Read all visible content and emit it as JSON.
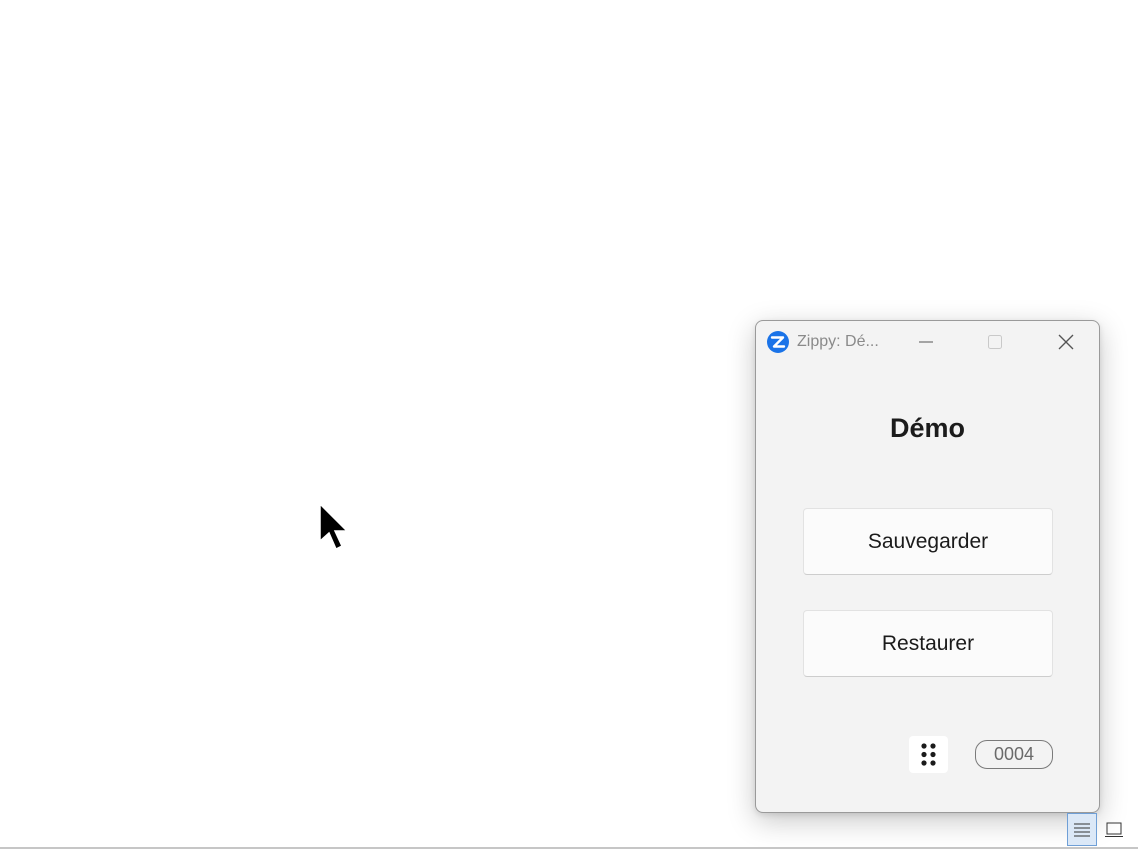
{
  "window": {
    "title": "Zippy: Dé...",
    "icon": "zippy-app-icon",
    "controls": {
      "minimize_icon": "minimize-icon",
      "maximize_icon": "maximize-icon",
      "close_icon": "close-icon"
    }
  },
  "main": {
    "heading": "Démo",
    "save_label": "Sauvegarder",
    "restore_label": "Restaurer"
  },
  "footer": {
    "grip_icon": "drag-handle-icon",
    "counter": "0004"
  },
  "statusbar": {
    "views": [
      "normal-view-icon",
      "layout-view-icon"
    ]
  },
  "colors": {
    "accent": "#1a73e8",
    "window_bg": "#f3f3f3",
    "button_bg": "#fbfbfb"
  }
}
